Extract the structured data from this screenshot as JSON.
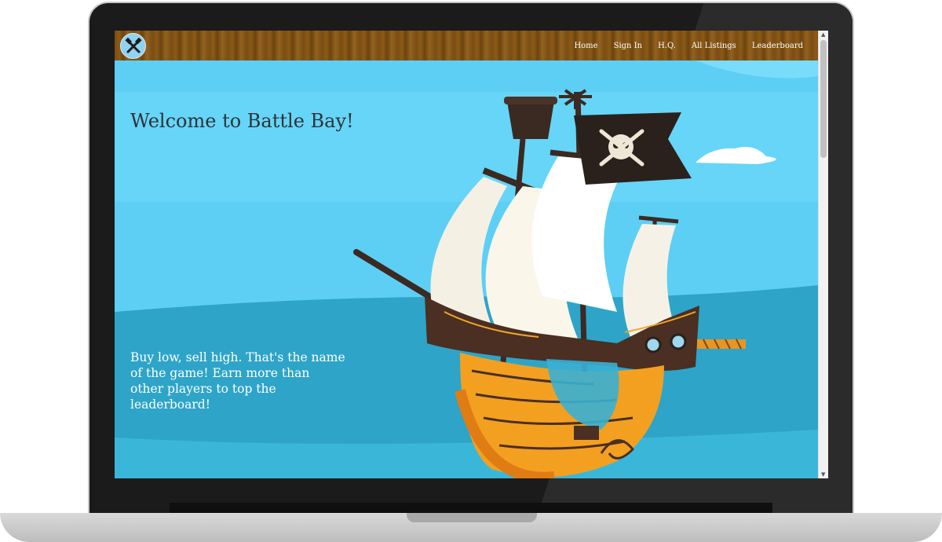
{
  "app": {
    "logo_icon": "crossed-hammers-icon"
  },
  "nav": {
    "items": [
      {
        "label": "Home"
      },
      {
        "label": "Sign In"
      },
      {
        "label": "H.Q."
      },
      {
        "label": "All Listings"
      },
      {
        "label": "Leaderboard"
      }
    ]
  },
  "hero": {
    "title": "Welcome to Battle Bay!",
    "tagline": "Buy low, sell high. That's the name of the game! Earn more than other players to top the leaderboard!",
    "illustration": "pirate-ship-illustration"
  },
  "colors": {
    "sky": "#5dcff5",
    "sea": "#2ea4c8",
    "navbar_wood": "#7a4d12",
    "title_text": "#2d3338"
  }
}
